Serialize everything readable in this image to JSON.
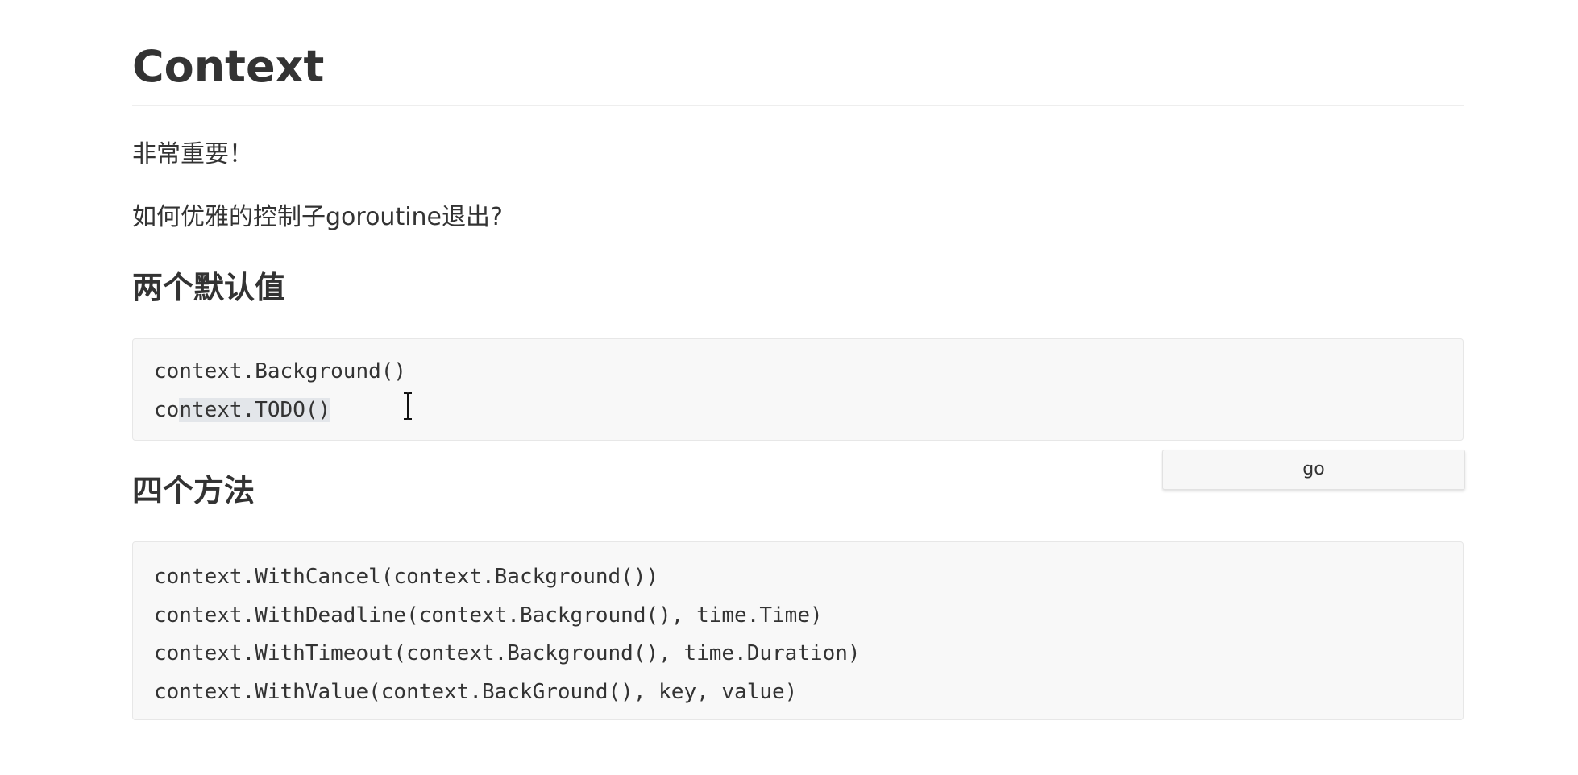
{
  "document": {
    "title": "Context",
    "intro_line1": "非常重要！",
    "intro_line2": "如何优雅的控制子goroutine退出?",
    "section1": {
      "heading": "两个默认值",
      "code_lines": [
        "context.Background()",
        "context.TODO()"
      ],
      "selected_line_prefix": "co",
      "selected_line_selection": "ntext.TODO()"
    },
    "section2": {
      "heading": "四个方法",
      "code_lines": [
        "context.WithCancel(context.Background())",
        "context.WithDeadline(context.Background(), time.Time)",
        "context.WithTimeout(context.Background(), time.Duration)",
        "context.WithValue(context.BackGround(), key, value)"
      ]
    }
  },
  "controls": {
    "go_button_label": "go"
  },
  "icons": {
    "cursor": "text-cursor-icon"
  }
}
